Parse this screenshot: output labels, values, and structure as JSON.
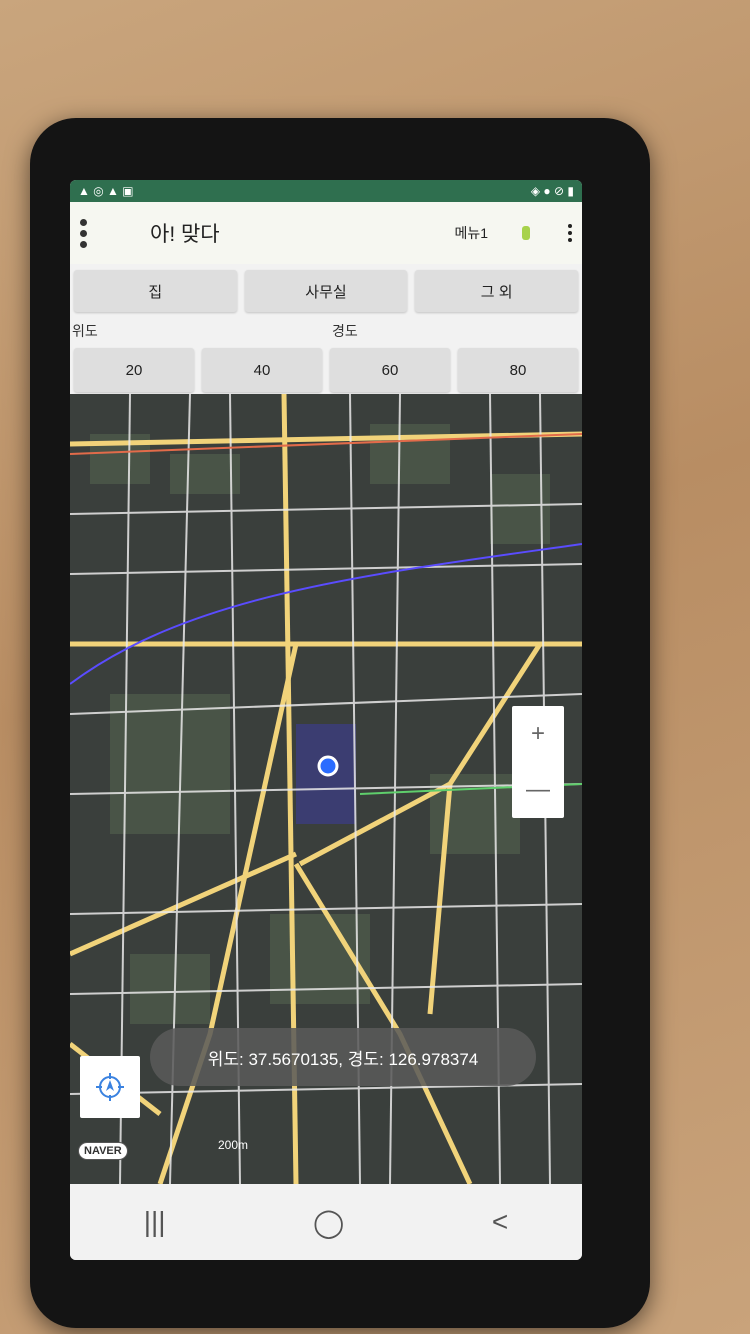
{
  "statusbar": {
    "left_icons": "▲ ◎ ▲ ▣",
    "right_icons": "◈ ● ⊘ ▮"
  },
  "appbar": {
    "title": "아! 맞다",
    "menu1": "메뉴1"
  },
  "places": [
    {
      "label": "집"
    },
    {
      "label": "사무실"
    },
    {
      "label": "그 외"
    }
  ],
  "coord_labels": {
    "lat": "위도",
    "lng": "경도"
  },
  "numbers": [
    {
      "label": "20"
    },
    {
      "label": "40"
    },
    {
      "label": "60"
    },
    {
      "label": "80"
    }
  ],
  "map": {
    "toast": "위도: 37.5670135, 경도: 126.978374",
    "scale_label": "200m",
    "logo": "NAVER",
    "zoom_in": "+",
    "zoom_out": "—"
  },
  "navbar": {
    "recent": "|||",
    "home": "◯",
    "back": "<"
  },
  "colors": {
    "status_bar": "#2f6f4f",
    "appbar": "#f6f7f1",
    "button": "#dedede",
    "location_dot": "#2b6cff"
  }
}
